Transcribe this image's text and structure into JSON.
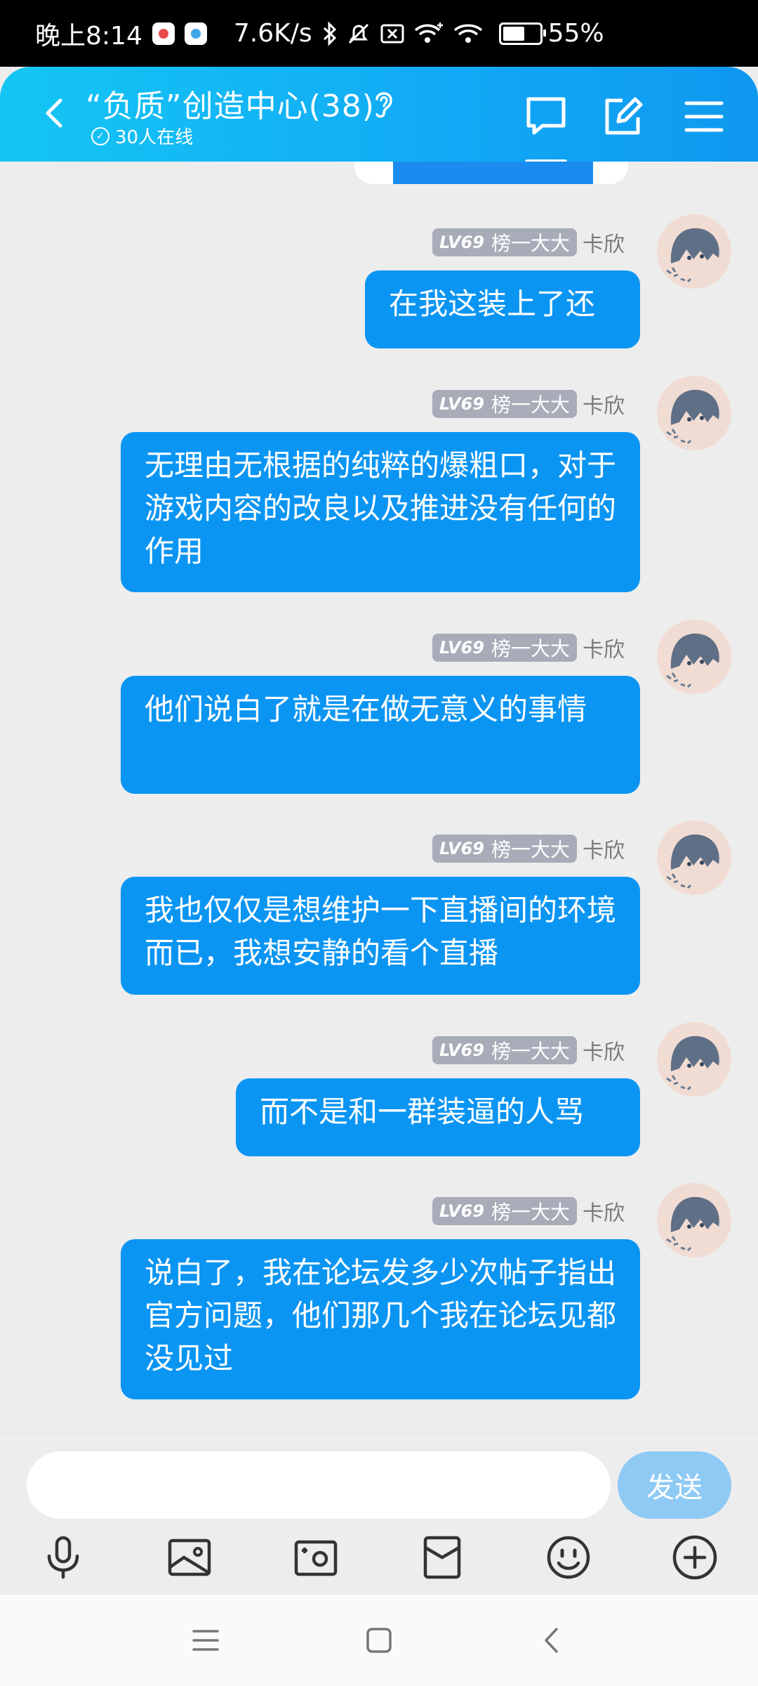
{
  "status_bar": {
    "time": "晚上8:14",
    "net_speed": "7.6K/s",
    "battery": "55%",
    "battery_level": 0.55,
    "icons": [
      "app-icon-red",
      "app-icon-blue",
      "bluetooth-icon",
      "mute-icon",
      "no-sim-icon",
      "wifi-plus-icon",
      "wifi-icon",
      "battery-icon"
    ]
  },
  "header": {
    "title": "“负质”创造中心(38)",
    "online": "30人在线",
    "icons": [
      "back-icon",
      "ear-icon",
      "chat-icon",
      "edit-icon",
      "menu-icon"
    ]
  },
  "messages": [
    {
      "level": "LV69",
      "tag": "榜一大大",
      "nickname": "卡欣",
      "text": "在我这装上了还"
    },
    {
      "level": "LV69",
      "tag": "榜一大大",
      "nickname": "卡欣",
      "text": "无理由无根据的纯粹的爆粗口，对于游戏内容的改良以及推进没有任何的作用"
    },
    {
      "level": "LV69",
      "tag": "榜一大大",
      "nickname": "卡欣",
      "text": "他们说白了就是在做无意义的事情"
    },
    {
      "level": "LV69",
      "tag": "榜一大大",
      "nickname": "卡欣",
      "text": "我也仅仅是想维护一下直播间的环境而已，我想安静的看个直播"
    },
    {
      "level": "LV69",
      "tag": "榜一大大",
      "nickname": "卡欣",
      "text": "而不是和一群装逼的人骂"
    },
    {
      "level": "LV69",
      "tag": "榜一大大",
      "nickname": "卡欣",
      "text": "说白了，我在论坛发多少次帖子指出官方问题，他们那几个我在论坛见都没见过"
    }
  ],
  "input": {
    "value": "",
    "send_label": "发送"
  },
  "toolbar": [
    "mic-icon",
    "image-icon",
    "camera-icon",
    "red-packet-icon",
    "emoji-icon",
    "plus-icon"
  ],
  "navbar": [
    "nav-menu-icon",
    "nav-home-icon",
    "nav-back-icon"
  ],
  "colors": {
    "header": "#11a9f5",
    "bubble": "#0b95f3",
    "badge": "#a8acb8",
    "send": "#8fcaf5",
    "background": "#ededed"
  }
}
